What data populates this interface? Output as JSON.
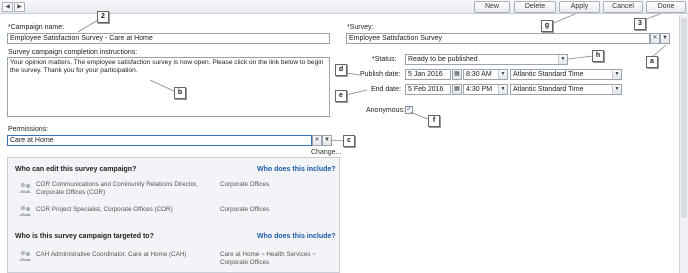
{
  "toolbar": {
    "back_icon": "left-arrow-icon",
    "forward_icon": "right-arrow-icon",
    "new_label": "New",
    "delete_label": "Delete",
    "apply_label": "Apply",
    "cancel_label": "Cancel",
    "done_label": "Done"
  },
  "form": {
    "campaign_name_label": "*Campaign name:",
    "campaign_name_value": "Employee Satisfaction Survey - Care at Home",
    "instructions_label": "Survey campaign completion instructions:",
    "instructions_value": "Your opinion matters. The employee satisfaction survey is now open.  Please click on the link below to begin the survey. Thank you for your participation.",
    "survey_label": "*Survey:",
    "survey_value": "Employee Satisfaction Survey",
    "status_label": "*Status:",
    "status_value": "Ready to be published",
    "publish_label": "Publish date:",
    "publish_date": "5 Jan 2016",
    "publish_time": "8:30 AM",
    "publish_tz": "Atlantic Standard Time",
    "end_label": "End date:",
    "end_date": "5 Feb 2016",
    "end_time": "4:30 PM",
    "end_tz": "Atlantic Standard Time",
    "anonymous_label": "Anonymous:",
    "anonymous_checked": true,
    "permissions_label": "Permissions:",
    "permissions_value": "Care at Home",
    "change_link": "Change..."
  },
  "permissions_panel": {
    "edit_title": "Who can edit this survey campaign?",
    "edit_link": "Who does this include?",
    "edit_rows": [
      {
        "name": "COR Communications and Community Relations Director, Corporate Offices (COR)",
        "org": "Corporate Offices"
      },
      {
        "name": "COR Project Specialist, Corporate Offices (COR)",
        "org": "Corporate Offices"
      }
    ],
    "target_title": "Who is this survey campaign targeted to?",
    "target_link": "Who does this include?",
    "target_rows": [
      {
        "name": "CAH Administrative Coordinator, Care at Home (CAH)",
        "org": "Care at Home ~ Health Services ~ Corporate Offices"
      }
    ]
  },
  "callouts": {
    "c2": "2",
    "c3": "3",
    "a": "a",
    "b": "b",
    "c": "c",
    "d": "d",
    "e": "e",
    "f": "f",
    "g": "g",
    "h": "h"
  },
  "colors": {
    "accent_link": "#1d5aa8",
    "panel_bg": "#f2f4f7",
    "border": "#9aa4b1"
  }
}
